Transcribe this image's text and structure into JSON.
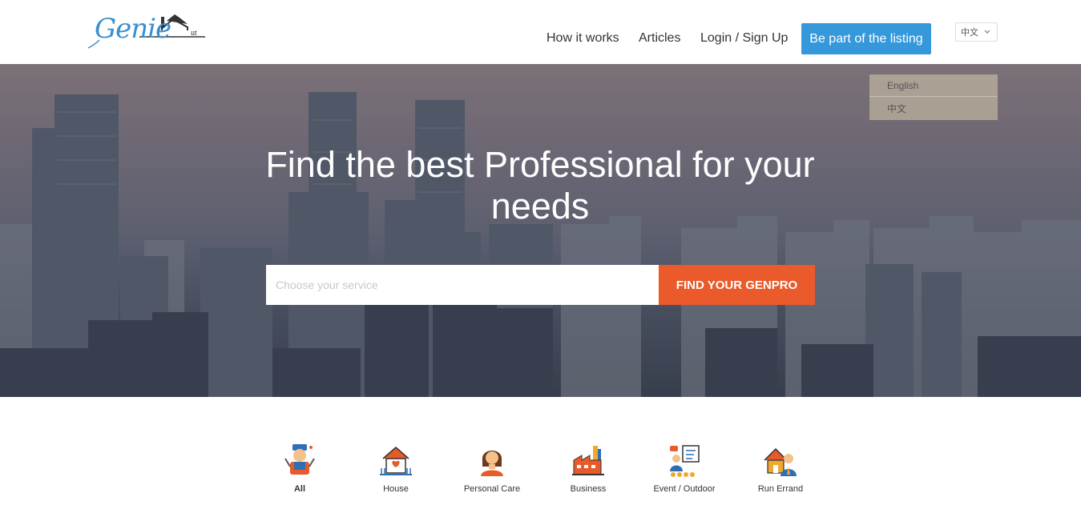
{
  "header": {
    "logo_text": "Genie",
    "logo_suffix": "ut",
    "nav": {
      "how_it_works": "How it works",
      "articles": "Articles",
      "login": "Login / Sign Up",
      "cta": "Be part of the listing"
    },
    "language": {
      "selected": "中文",
      "options": [
        "English",
        "中文"
      ]
    }
  },
  "hero": {
    "title": "Find the best Professional for your needs",
    "search_placeholder": "Choose your service",
    "search_value": "",
    "search_button": "FIND YOUR GENPRO"
  },
  "categories": [
    {
      "label": "All",
      "icon": "handyman-icon",
      "active": true
    },
    {
      "label": "House",
      "icon": "house-icon",
      "active": false
    },
    {
      "label": "Personal Care",
      "icon": "person-icon",
      "active": false
    },
    {
      "label": "Business",
      "icon": "factory-icon",
      "active": false
    },
    {
      "label": "Event / Outdoor",
      "icon": "presentation-icon",
      "active": false
    },
    {
      "label": "Run Errand",
      "icon": "errand-icon",
      "active": false
    }
  ],
  "colors": {
    "brand_blue": "#3498db",
    "search_orange": "#ea5a2a",
    "logo_blue": "#3a8fcf"
  }
}
